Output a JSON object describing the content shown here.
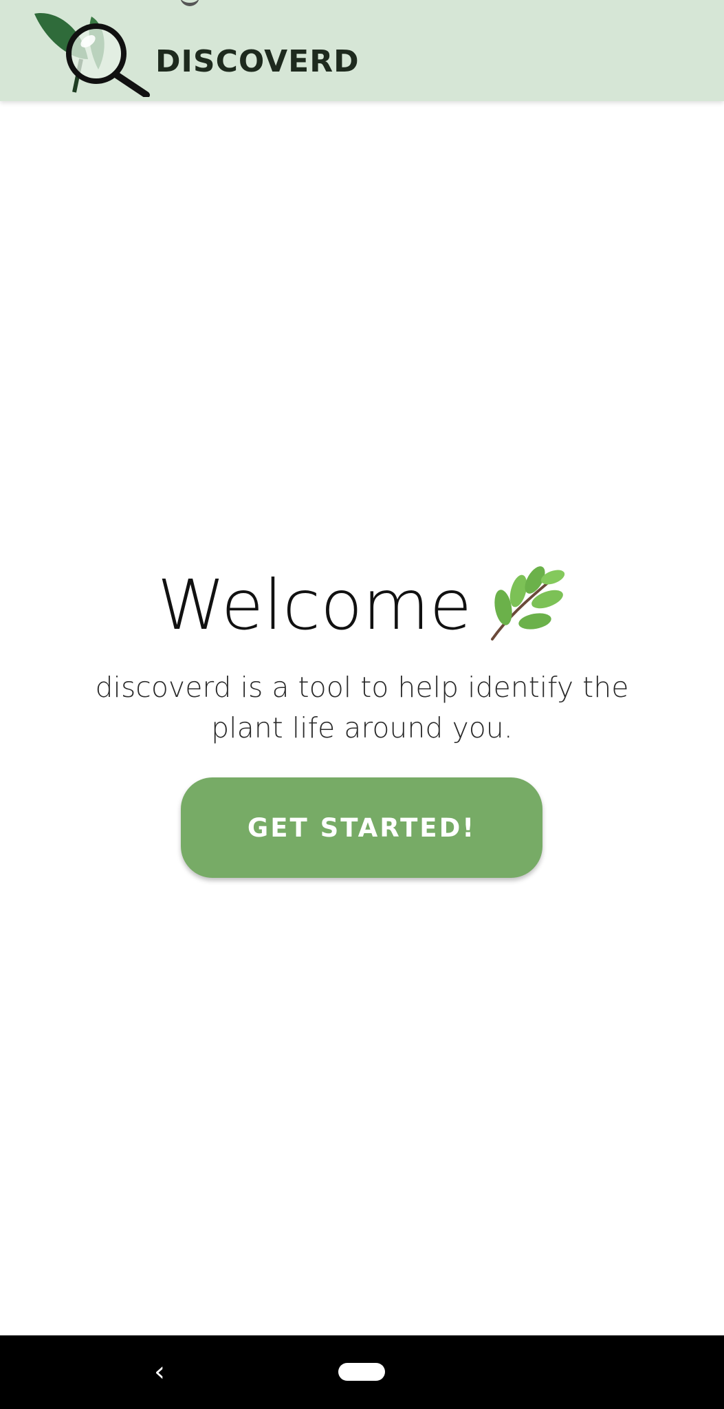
{
  "app_bar": {
    "brand": "DISCOVERD",
    "logo_icon": "leaf-magnifier-logo-icon",
    "background_color": "#d6e6d6"
  },
  "welcome": {
    "title": "Welcome",
    "title_icon": "herb-leaf-icon",
    "subtitle": "discoverd is a tool to help identify the plant life around you."
  },
  "cta": {
    "label": "GET STARTED!",
    "color": "#77ab66"
  },
  "nav_bar": {
    "back_icon": "back-chevron-icon",
    "home_icon": "home-pill-icon"
  }
}
